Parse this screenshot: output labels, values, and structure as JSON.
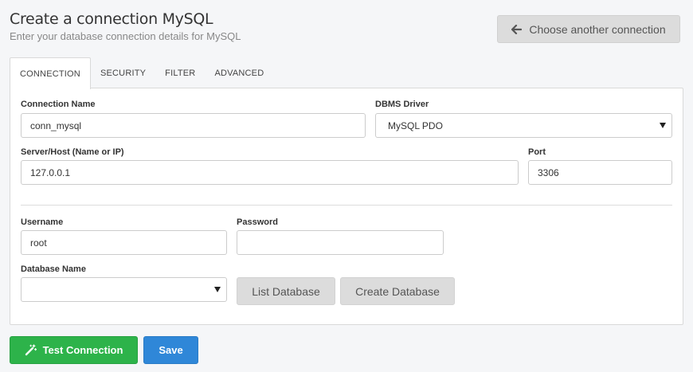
{
  "header": {
    "title": "Create a connection MySQL",
    "subtitle": "Enter your database connection details for MySQL",
    "back_button": {
      "label": "Choose another connection",
      "icon": "arrow-left-icon"
    }
  },
  "tabs": [
    {
      "label": "CONNECTION",
      "active": true
    },
    {
      "label": "SECURITY",
      "active": false
    },
    {
      "label": "FILTER",
      "active": false
    },
    {
      "label": "ADVANCED",
      "active": false
    }
  ],
  "form": {
    "connection_name": {
      "label": "Connection Name",
      "value": "conn_mysql"
    },
    "dbms_driver": {
      "label": "DBMS Driver",
      "value": "MySQL PDO"
    },
    "server_host": {
      "label": "Server/Host (Name or IP)",
      "value": "127.0.0.1"
    },
    "port": {
      "label": "Port",
      "value": "3306"
    },
    "username": {
      "label": "Username",
      "value": "root"
    },
    "password": {
      "label": "Password",
      "value": ""
    },
    "database_name": {
      "label": "Database Name",
      "value": ""
    },
    "list_database_label": "List Database",
    "create_database_label": "Create Database"
  },
  "footer": {
    "test_connection_label": "Test Connection",
    "test_connection_icon": "magic-wand-icon",
    "save_label": "Save"
  },
  "colors": {
    "test_button": "#2db34a",
    "save_button": "#2f87d8",
    "gray_button": "#dcdcdc"
  }
}
